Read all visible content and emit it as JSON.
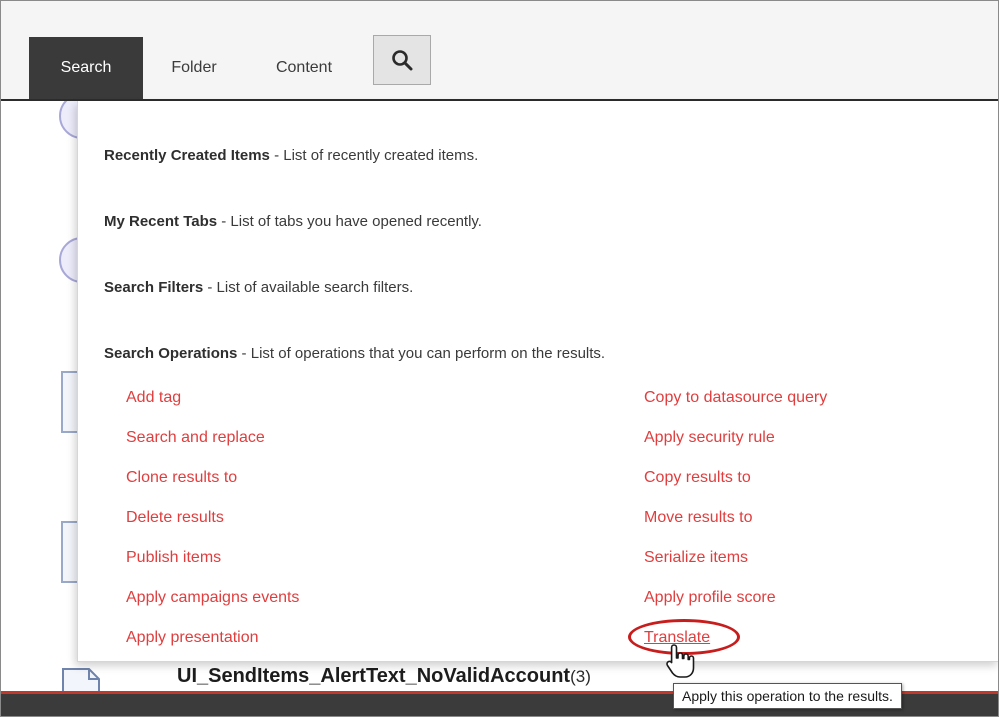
{
  "tabs": [
    {
      "label": "Search",
      "active": true
    },
    {
      "label": "Folder",
      "active": false
    },
    {
      "label": "Content",
      "active": false
    }
  ],
  "search_button": {
    "icon": "search-icon"
  },
  "panel": {
    "sections": [
      {
        "title": "Recently Created Items",
        "description": " - List of recently created items."
      },
      {
        "title": "My Recent Tabs",
        "description": " - List of tabs you have opened recently."
      },
      {
        "title": "Search Filters",
        "description": " - List of available search filters."
      },
      {
        "title": "Search Operations",
        "description": " - List of operations that you can perform on the results."
      }
    ],
    "operations_left": [
      "Add tag",
      "Search and replace",
      "Clone results to",
      "Delete results",
      "Publish items",
      "Apply campaigns events",
      "Apply presentation"
    ],
    "operations_right": [
      "Copy to datasource query",
      "Apply security rule",
      "Copy results to",
      "Move results to",
      "Serialize items",
      "Apply profile score",
      "Translate"
    ]
  },
  "background_item": {
    "label": "UI_SendItems_AlertText_NoValidAccount",
    "count": "(3)"
  },
  "tooltip": "Apply this operation to the results.",
  "colors": {
    "link": "#e03e3e",
    "highlight_ring": "#c81d1d",
    "active_tab": "#3a3a3a"
  }
}
